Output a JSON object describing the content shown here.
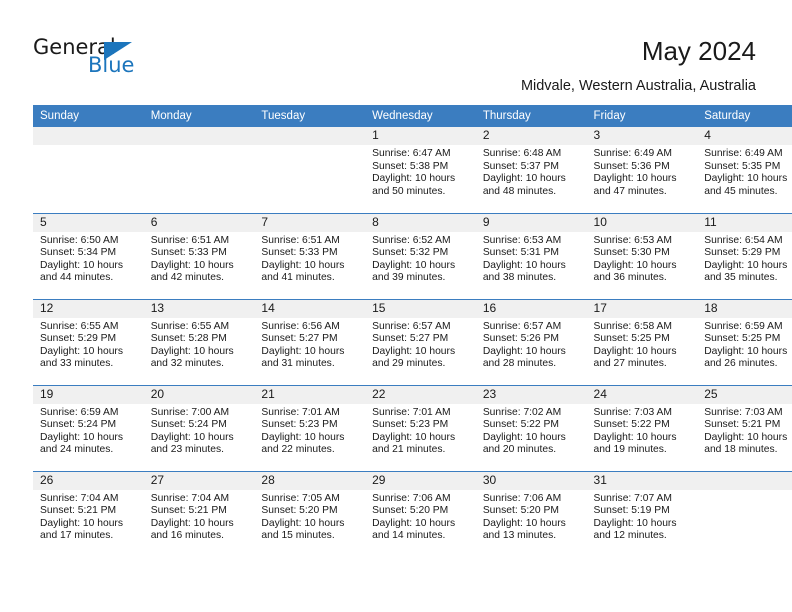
{
  "brand": {
    "name_top": "General",
    "name_bottom": "Blue",
    "accent_color": "#1c75bc",
    "triangle_icon": "triangle-icon"
  },
  "header": {
    "title": "May 2024",
    "location": "Midvale, Western Australia, Australia"
  },
  "theme": {
    "header_bg": "#3b7dc0",
    "daynum_bg": "#f0f0f0",
    "grid_line": "#3b7dc0",
    "text": "#1a1a1a"
  },
  "calendar": {
    "weekday_headers": [
      "Sunday",
      "Monday",
      "Tuesday",
      "Wednesday",
      "Thursday",
      "Friday",
      "Saturday"
    ],
    "weeks": [
      [
        {
          "day": "",
          "sunrise": "",
          "sunset": "",
          "daylight_line1": "",
          "daylight_line2": ""
        },
        {
          "day": "",
          "sunrise": "",
          "sunset": "",
          "daylight_line1": "",
          "daylight_line2": ""
        },
        {
          "day": "",
          "sunrise": "",
          "sunset": "",
          "daylight_line1": "",
          "daylight_line2": ""
        },
        {
          "day": "1",
          "sunrise": "Sunrise: 6:47 AM",
          "sunset": "Sunset: 5:38 PM",
          "daylight_line1": "Daylight: 10 hours",
          "daylight_line2": "and 50 minutes."
        },
        {
          "day": "2",
          "sunrise": "Sunrise: 6:48 AM",
          "sunset": "Sunset: 5:37 PM",
          "daylight_line1": "Daylight: 10 hours",
          "daylight_line2": "and 48 minutes."
        },
        {
          "day": "3",
          "sunrise": "Sunrise: 6:49 AM",
          "sunset": "Sunset: 5:36 PM",
          "daylight_line1": "Daylight: 10 hours",
          "daylight_line2": "and 47 minutes."
        },
        {
          "day": "4",
          "sunrise": "Sunrise: 6:49 AM",
          "sunset": "Sunset: 5:35 PM",
          "daylight_line1": "Daylight: 10 hours",
          "daylight_line2": "and 45 minutes."
        }
      ],
      [
        {
          "day": "5",
          "sunrise": "Sunrise: 6:50 AM",
          "sunset": "Sunset: 5:34 PM",
          "daylight_line1": "Daylight: 10 hours",
          "daylight_line2": "and 44 minutes."
        },
        {
          "day": "6",
          "sunrise": "Sunrise: 6:51 AM",
          "sunset": "Sunset: 5:33 PM",
          "daylight_line1": "Daylight: 10 hours",
          "daylight_line2": "and 42 minutes."
        },
        {
          "day": "7",
          "sunrise": "Sunrise: 6:51 AM",
          "sunset": "Sunset: 5:33 PM",
          "daylight_line1": "Daylight: 10 hours",
          "daylight_line2": "and 41 minutes."
        },
        {
          "day": "8",
          "sunrise": "Sunrise: 6:52 AM",
          "sunset": "Sunset: 5:32 PM",
          "daylight_line1": "Daylight: 10 hours",
          "daylight_line2": "and 39 minutes."
        },
        {
          "day": "9",
          "sunrise": "Sunrise: 6:53 AM",
          "sunset": "Sunset: 5:31 PM",
          "daylight_line1": "Daylight: 10 hours",
          "daylight_line2": "and 38 minutes."
        },
        {
          "day": "10",
          "sunrise": "Sunrise: 6:53 AM",
          "sunset": "Sunset: 5:30 PM",
          "daylight_line1": "Daylight: 10 hours",
          "daylight_line2": "and 36 minutes."
        },
        {
          "day": "11",
          "sunrise": "Sunrise: 6:54 AM",
          "sunset": "Sunset: 5:29 PM",
          "daylight_line1": "Daylight: 10 hours",
          "daylight_line2": "and 35 minutes."
        }
      ],
      [
        {
          "day": "12",
          "sunrise": "Sunrise: 6:55 AM",
          "sunset": "Sunset: 5:29 PM",
          "daylight_line1": "Daylight: 10 hours",
          "daylight_line2": "and 33 minutes."
        },
        {
          "day": "13",
          "sunrise": "Sunrise: 6:55 AM",
          "sunset": "Sunset: 5:28 PM",
          "daylight_line1": "Daylight: 10 hours",
          "daylight_line2": "and 32 minutes."
        },
        {
          "day": "14",
          "sunrise": "Sunrise: 6:56 AM",
          "sunset": "Sunset: 5:27 PM",
          "daylight_line1": "Daylight: 10 hours",
          "daylight_line2": "and 31 minutes."
        },
        {
          "day": "15",
          "sunrise": "Sunrise: 6:57 AM",
          "sunset": "Sunset: 5:27 PM",
          "daylight_line1": "Daylight: 10 hours",
          "daylight_line2": "and 29 minutes."
        },
        {
          "day": "16",
          "sunrise": "Sunrise: 6:57 AM",
          "sunset": "Sunset: 5:26 PM",
          "daylight_line1": "Daylight: 10 hours",
          "daylight_line2": "and 28 minutes."
        },
        {
          "day": "17",
          "sunrise": "Sunrise: 6:58 AM",
          "sunset": "Sunset: 5:25 PM",
          "daylight_line1": "Daylight: 10 hours",
          "daylight_line2": "and 27 minutes."
        },
        {
          "day": "18",
          "sunrise": "Sunrise: 6:59 AM",
          "sunset": "Sunset: 5:25 PM",
          "daylight_line1": "Daylight: 10 hours",
          "daylight_line2": "and 26 minutes."
        }
      ],
      [
        {
          "day": "19",
          "sunrise": "Sunrise: 6:59 AM",
          "sunset": "Sunset: 5:24 PM",
          "daylight_line1": "Daylight: 10 hours",
          "daylight_line2": "and 24 minutes."
        },
        {
          "day": "20",
          "sunrise": "Sunrise: 7:00 AM",
          "sunset": "Sunset: 5:24 PM",
          "daylight_line1": "Daylight: 10 hours",
          "daylight_line2": "and 23 minutes."
        },
        {
          "day": "21",
          "sunrise": "Sunrise: 7:01 AM",
          "sunset": "Sunset: 5:23 PM",
          "daylight_line1": "Daylight: 10 hours",
          "daylight_line2": "and 22 minutes."
        },
        {
          "day": "22",
          "sunrise": "Sunrise: 7:01 AM",
          "sunset": "Sunset: 5:23 PM",
          "daylight_line1": "Daylight: 10 hours",
          "daylight_line2": "and 21 minutes."
        },
        {
          "day": "23",
          "sunrise": "Sunrise: 7:02 AM",
          "sunset": "Sunset: 5:22 PM",
          "daylight_line1": "Daylight: 10 hours",
          "daylight_line2": "and 20 minutes."
        },
        {
          "day": "24",
          "sunrise": "Sunrise: 7:03 AM",
          "sunset": "Sunset: 5:22 PM",
          "daylight_line1": "Daylight: 10 hours",
          "daylight_line2": "and 19 minutes."
        },
        {
          "day": "25",
          "sunrise": "Sunrise: 7:03 AM",
          "sunset": "Sunset: 5:21 PM",
          "daylight_line1": "Daylight: 10 hours",
          "daylight_line2": "and 18 minutes."
        }
      ],
      [
        {
          "day": "26",
          "sunrise": "Sunrise: 7:04 AM",
          "sunset": "Sunset: 5:21 PM",
          "daylight_line1": "Daylight: 10 hours",
          "daylight_line2": "and 17 minutes."
        },
        {
          "day": "27",
          "sunrise": "Sunrise: 7:04 AM",
          "sunset": "Sunset: 5:21 PM",
          "daylight_line1": "Daylight: 10 hours",
          "daylight_line2": "and 16 minutes."
        },
        {
          "day": "28",
          "sunrise": "Sunrise: 7:05 AM",
          "sunset": "Sunset: 5:20 PM",
          "daylight_line1": "Daylight: 10 hours",
          "daylight_line2": "and 15 minutes."
        },
        {
          "day": "29",
          "sunrise": "Sunrise: 7:06 AM",
          "sunset": "Sunset: 5:20 PM",
          "daylight_line1": "Daylight: 10 hours",
          "daylight_line2": "and 14 minutes."
        },
        {
          "day": "30",
          "sunrise": "Sunrise: 7:06 AM",
          "sunset": "Sunset: 5:20 PM",
          "daylight_line1": "Daylight: 10 hours",
          "daylight_line2": "and 13 minutes."
        },
        {
          "day": "31",
          "sunrise": "Sunrise: 7:07 AM",
          "sunset": "Sunset: 5:19 PM",
          "daylight_line1": "Daylight: 10 hours",
          "daylight_line2": "and 12 minutes."
        },
        {
          "day": "",
          "sunrise": "",
          "sunset": "",
          "daylight_line1": "",
          "daylight_line2": ""
        }
      ]
    ]
  }
}
